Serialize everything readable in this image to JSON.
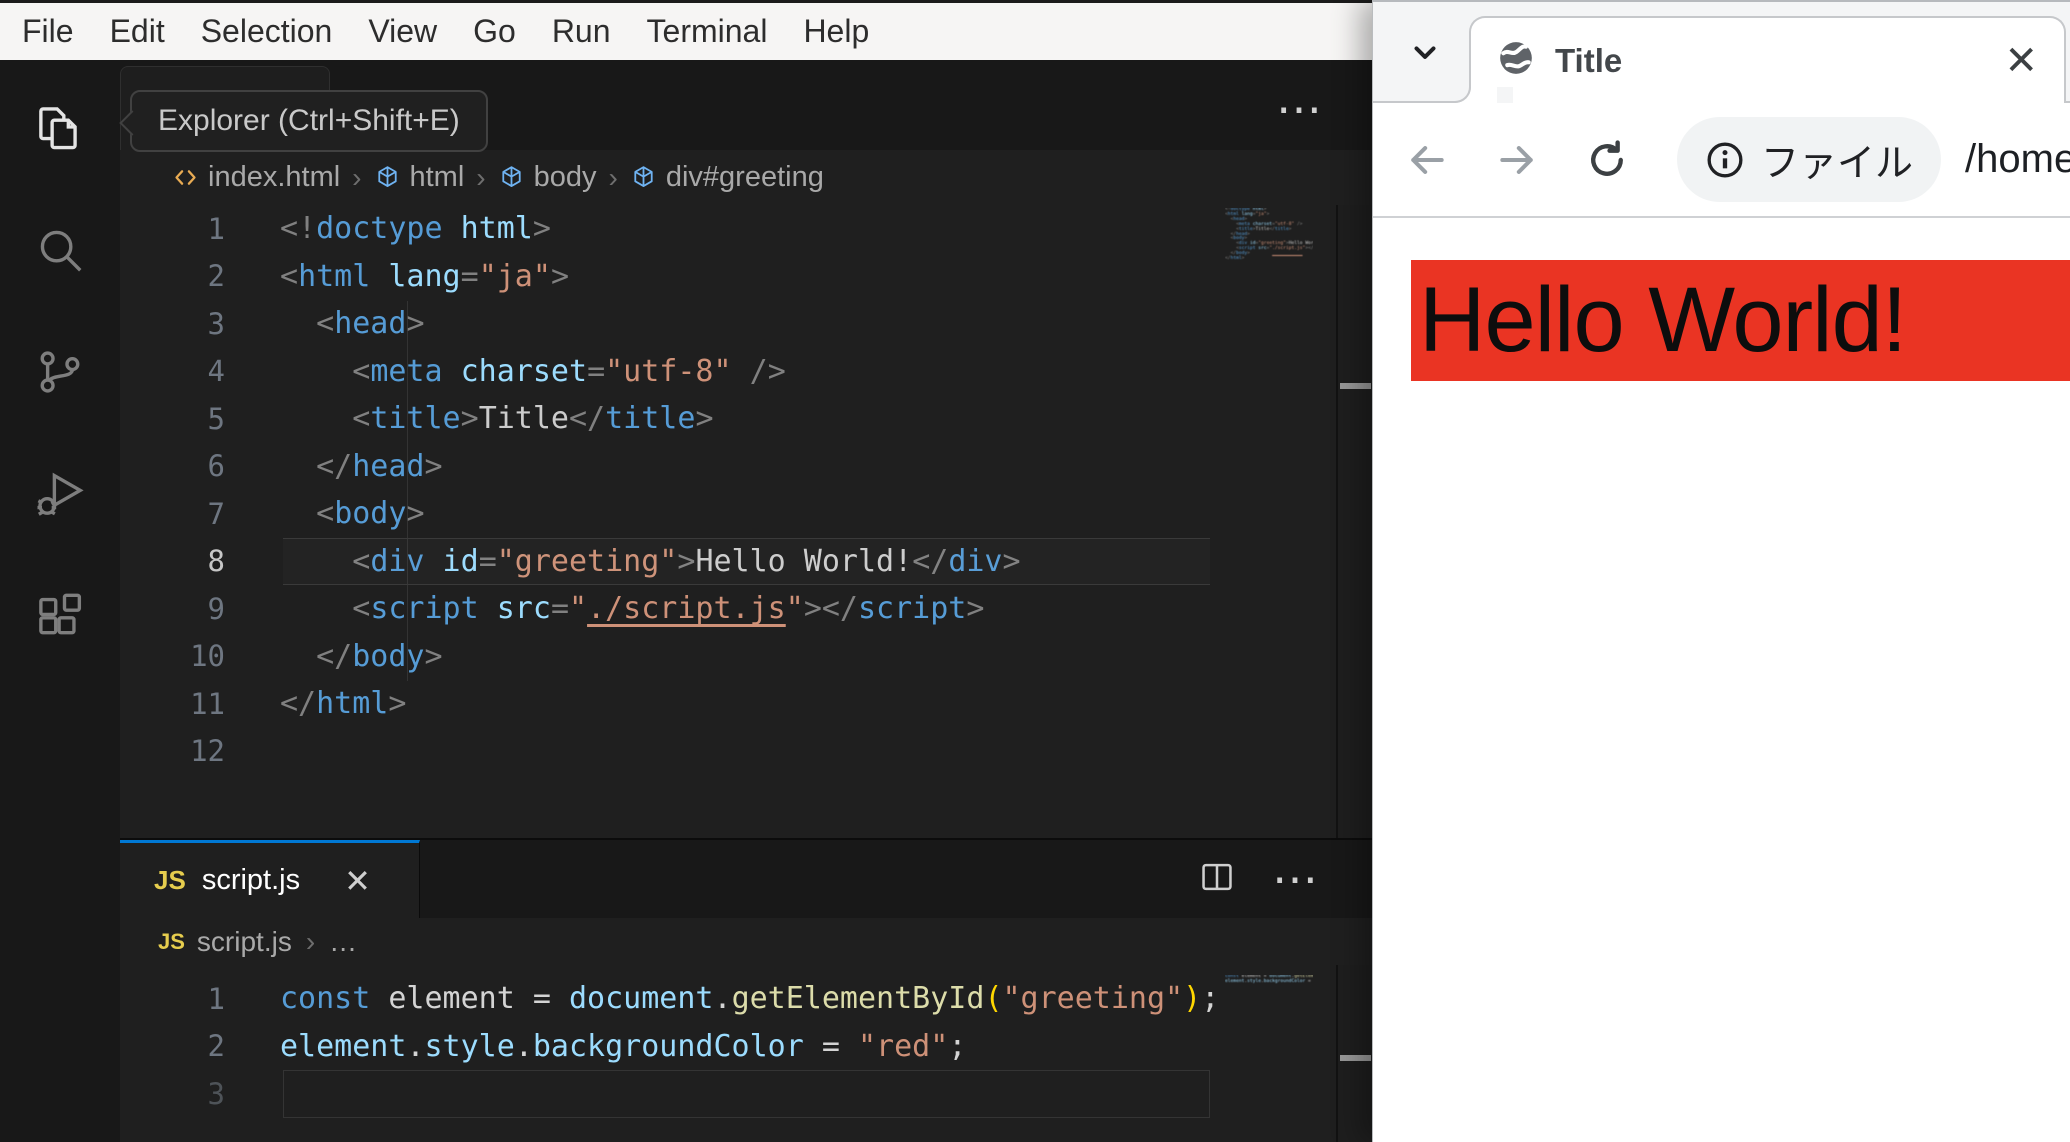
{
  "vscode": {
    "menu": [
      "File",
      "Edit",
      "Selection",
      "View",
      "Go",
      "Run",
      "Terminal",
      "Help"
    ],
    "activity_bar": [
      {
        "icon": "explorer-icon",
        "active": true
      },
      {
        "icon": "search-icon",
        "active": false
      },
      {
        "icon": "source-control-icon",
        "active": false
      },
      {
        "icon": "run-debug-icon",
        "active": false
      },
      {
        "icon": "extensions-icon",
        "active": false
      }
    ],
    "tooltip": "Explorer (Ctrl+Shift+E)",
    "top_editor": {
      "more_actions": "⋯",
      "breadcrumbs": [
        {
          "icon": "code",
          "label": "index.html"
        },
        {
          "icon": "cube",
          "label": "html"
        },
        {
          "icon": "cube",
          "label": "body"
        },
        {
          "icon": "cube",
          "label": "div#greeting"
        }
      ],
      "breadcrumb_separator": "›",
      "active_line": 8,
      "lines": [
        [
          [
            "<!",
            "pun"
          ],
          [
            "doctype",
            "tag"
          ],
          [
            " html",
            "attr"
          ],
          [
            ">",
            "pun"
          ]
        ],
        [
          [
            "<",
            "pun"
          ],
          [
            "html",
            "tag"
          ],
          [
            " lang",
            "attr"
          ],
          [
            "=",
            "pun"
          ],
          [
            "\"ja\"",
            "str"
          ],
          [
            ">",
            "pun"
          ]
        ],
        [
          [
            "  ",
            "pln"
          ],
          [
            "<",
            "pun"
          ],
          [
            "head",
            "tag"
          ],
          [
            ">",
            "pun"
          ]
        ],
        [
          [
            "    ",
            "pln"
          ],
          [
            "<",
            "pun"
          ],
          [
            "meta",
            "tag"
          ],
          [
            " charset",
            "attr"
          ],
          [
            "=",
            "pun"
          ],
          [
            "\"utf-8\"",
            "str"
          ],
          [
            " /",
            "pun"
          ],
          [
            ">",
            "pun"
          ]
        ],
        [
          [
            "    ",
            "pln"
          ],
          [
            "<",
            "pun"
          ],
          [
            "title",
            "tag"
          ],
          [
            ">",
            "pun"
          ],
          [
            "Title",
            "txt"
          ],
          [
            "</",
            "pun"
          ],
          [
            "title",
            "tag"
          ],
          [
            ">",
            "pun"
          ]
        ],
        [
          [
            "  ",
            "pln"
          ],
          [
            "</",
            "pun"
          ],
          [
            "head",
            "tag"
          ],
          [
            ">",
            "pun"
          ]
        ],
        [
          [
            "  ",
            "pln"
          ],
          [
            "<",
            "pun"
          ],
          [
            "body",
            "tag"
          ],
          [
            ">",
            "pun"
          ]
        ],
        [
          [
            "    ",
            "pln"
          ],
          [
            "<",
            "pun"
          ],
          [
            "div",
            "tag"
          ],
          [
            " id",
            "attr"
          ],
          [
            "=",
            "pun"
          ],
          [
            "\"greeting\"",
            "str"
          ],
          [
            ">",
            "pun"
          ],
          [
            "Hello World!",
            "txt"
          ],
          [
            "</",
            "pun"
          ],
          [
            "div",
            "tag"
          ],
          [
            ">",
            "pun"
          ]
        ],
        [
          [
            "    ",
            "pln"
          ],
          [
            "<",
            "pun"
          ],
          [
            "script",
            "tag"
          ],
          [
            " src",
            "attr"
          ],
          [
            "=",
            "pun"
          ],
          [
            "\"",
            "str"
          ],
          [
            "./script.js",
            "lnk"
          ],
          [
            "\"",
            "str"
          ],
          [
            ">",
            "pun"
          ],
          [
            "</",
            "pun"
          ],
          [
            "script",
            "tag"
          ],
          [
            ">",
            "pun"
          ]
        ],
        [
          [
            "  ",
            "pln"
          ],
          [
            "</",
            "pun"
          ],
          [
            "body",
            "tag"
          ],
          [
            ">",
            "pun"
          ]
        ],
        [
          [
            "</",
            "pun"
          ],
          [
            "html",
            "tag"
          ],
          [
            ">",
            "pun"
          ]
        ],
        []
      ]
    },
    "bottom_editor": {
      "tab": {
        "badge": "JS",
        "label": "script.js",
        "close": "✕"
      },
      "more_actions": "⋯",
      "breadcrumbs": {
        "badge": "JS",
        "label": "script.js",
        "separator": "›",
        "more": "…"
      },
      "active_line": 3,
      "lines": [
        [
          [
            "const",
            "kw"
          ],
          [
            " element ",
            "pln"
          ],
          [
            "=",
            "pln"
          ],
          [
            " document",
            "attr"
          ],
          [
            ".",
            "pln"
          ],
          [
            "getElementById",
            "fn"
          ],
          [
            "(",
            "par"
          ],
          [
            "\"greeting\"",
            "str"
          ],
          [
            ")",
            "par"
          ],
          [
            ";",
            "pln"
          ]
        ],
        [
          [
            "element",
            "attr"
          ],
          [
            ".",
            "pln"
          ],
          [
            "style",
            "attr"
          ],
          [
            ".",
            "pln"
          ],
          [
            "backgroundColor",
            "attr"
          ],
          [
            " = ",
            "pln"
          ],
          [
            "\"red\"",
            "str"
          ],
          [
            ";",
            "pln"
          ]
        ],
        []
      ]
    },
    "colors": {
      "accent": "#0078d4",
      "editor_bg": "#1f1f1f",
      "panel_bg": "#181818"
    }
  },
  "browser": {
    "tab": {
      "title": "Title",
      "close": "✕"
    },
    "toolbar": {
      "chip_label": "ファイル",
      "url": "/home/u"
    },
    "page": {
      "heading": "Hello World!",
      "heading_bg": "#ea3423",
      "heading_color": "#0d0d0d"
    }
  }
}
